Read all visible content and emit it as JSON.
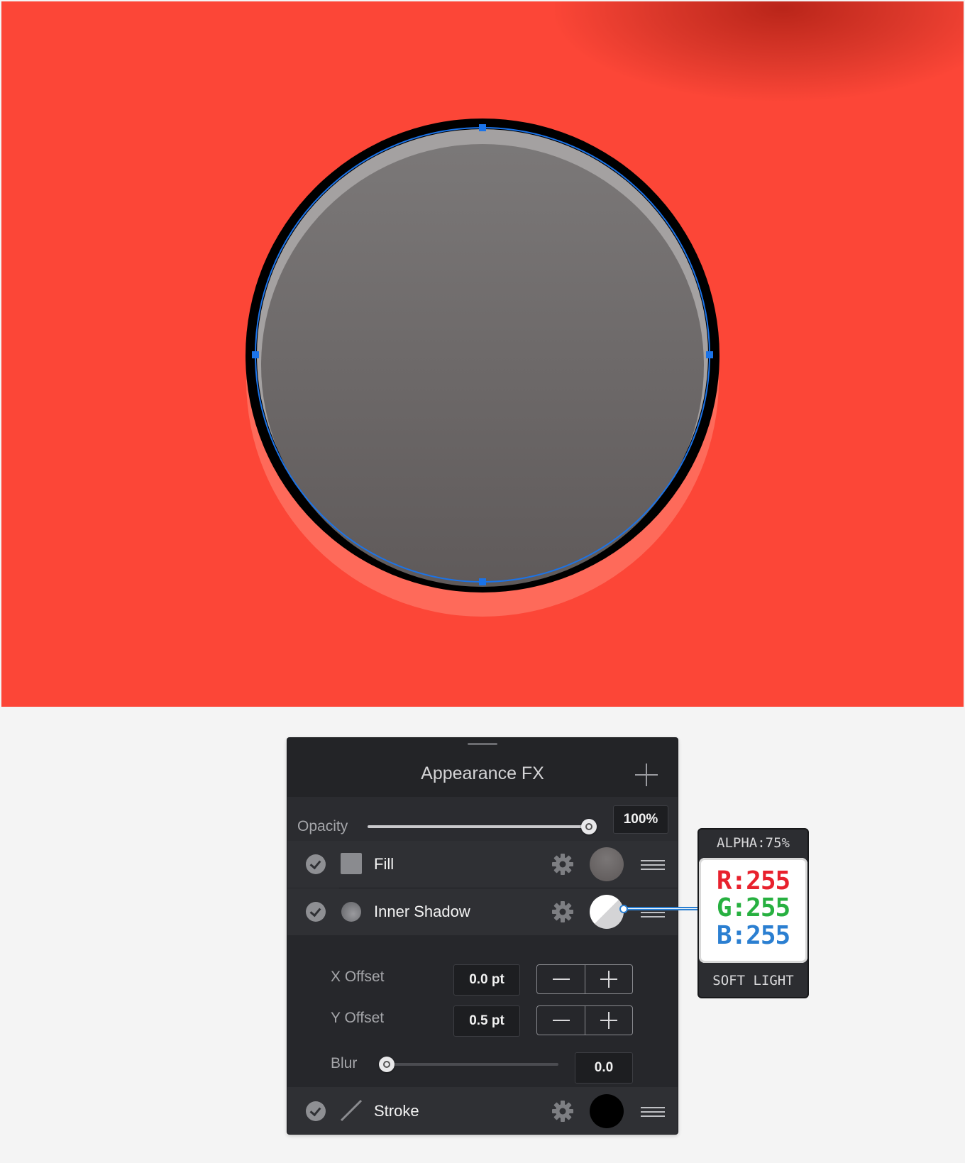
{
  "canvas": {
    "background_color": "#fc4637",
    "circle": {
      "fill_top": "#7b7878",
      "fill_bottom": "#5f5a5a",
      "stroke_color": "#000000",
      "shadow_color": "#fe6a5a",
      "selection_color": "#1b73e8"
    }
  },
  "panel": {
    "title": "Appearance FX",
    "add_icon": "plus-icon",
    "opacity": {
      "label": "Opacity",
      "value": "100%",
      "level": 1.0
    },
    "effects": [
      {
        "label": "Fill",
        "enabled": true,
        "icon": "square-icon",
        "swatch": "#6a6666"
      },
      {
        "label": "Inner Shadow",
        "enabled": true,
        "icon": "circle-icon",
        "swatch": "#ffffff"
      },
      {
        "label": "Stroke",
        "enabled": true,
        "icon": "line-icon",
        "swatch": "#000000"
      }
    ],
    "inner_shadow": {
      "x_offset": {
        "label": "X Offset",
        "value": "0.0 pt"
      },
      "y_offset": {
        "label": "Y Offset",
        "value": "0.5 pt"
      },
      "blur": {
        "label": "Blur",
        "value": "0.0",
        "level": 0.0
      }
    }
  },
  "callout": {
    "alpha": "ALPHA:75%",
    "r": "R:255",
    "g": "G:255",
    "b": "B:255",
    "blend_mode": "SOFT LIGHT",
    "colors": {
      "r": "#e8212d",
      "g": "#27b040",
      "b": "#2b7fd1"
    }
  }
}
